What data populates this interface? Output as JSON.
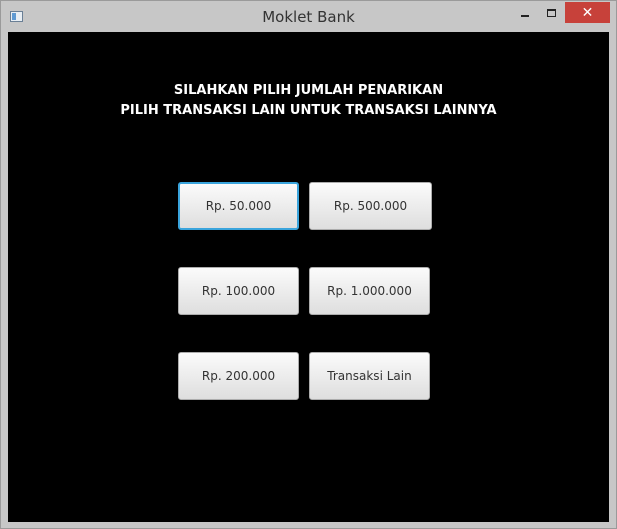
{
  "window": {
    "title": "Moklet Bank",
    "close_glyph": "✕",
    "icons": [
      "app-icon",
      "minimize-icon",
      "maximize-icon",
      "close-icon"
    ]
  },
  "heading": {
    "line1": "SILAHKAN PILIH JUMLAH PENARIKAN",
    "line2": "PILIH TRANSAKSI LAIN UNTUK TRANSAKSI LAINNYA"
  },
  "buttons": {
    "amount_50k": "Rp. 50.000",
    "amount_500k": "Rp. 500.000",
    "amount_100k": "Rp. 100.000",
    "amount_1m": "Rp. 1.000.000",
    "amount_200k": "Rp. 200.000",
    "other": "Transaksi Lain"
  },
  "colors": {
    "content_bg": "#000000",
    "focus_border": "#3aa4dc",
    "close_button": "#c7413a"
  }
}
